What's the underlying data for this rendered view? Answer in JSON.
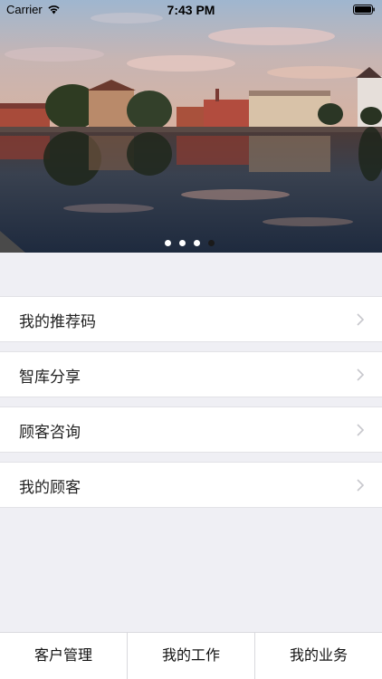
{
  "status_bar": {
    "carrier": "Carrier",
    "time": "7:43 PM",
    "wifi_icon": "wifi-icon",
    "battery_icon": "battery-icon"
  },
  "banner": {
    "page_count": 4,
    "active_page": 4
  },
  "menu": {
    "items": [
      {
        "label": "我的推荐码",
        "icon": "chevron-right-icon"
      },
      {
        "label": "智库分享",
        "icon": "chevron-right-icon"
      },
      {
        "label": "顾客咨询",
        "icon": "chevron-right-icon"
      },
      {
        "label": "我的顾客",
        "icon": "chevron-right-icon"
      }
    ]
  },
  "tabbar": {
    "tabs": [
      {
        "label": "客户管理"
      },
      {
        "label": "我的工作"
      },
      {
        "label": "我的业务"
      }
    ]
  },
  "colors": {
    "background": "#efeff4",
    "row_background": "#ffffff",
    "text": "#222222",
    "chevron": "#c7c7cc"
  }
}
